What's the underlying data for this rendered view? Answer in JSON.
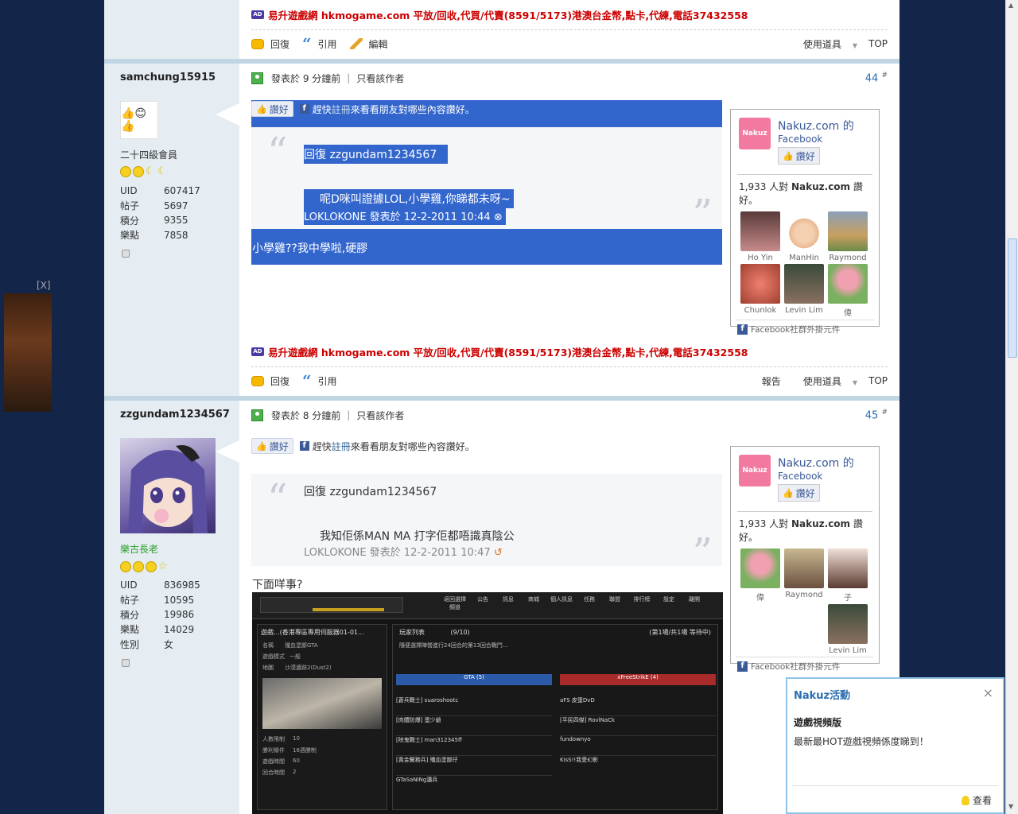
{
  "ad_text": "易升遊戲網 hkmogame.com 平放/回收,代買/代賣(8591/5173)港澳台金幣,點卡,代練,電話37432558",
  "ad_icon": "AD",
  "actions": {
    "reply": "回復",
    "quote": "引用",
    "edit": "編輯",
    "report": "報告",
    "tools": "使用道具",
    "top": "TOP"
  },
  "posts": [
    {
      "username": "samchung15915",
      "rank": "二十四級會員",
      "stats": [
        {
          "k": "UID",
          "v": "607417"
        },
        {
          "k": "帖子",
          "v": "5697"
        },
        {
          "k": "積分",
          "v": "9355"
        },
        {
          "k": "樂點",
          "v": "7858"
        }
      ],
      "posted": "發表於 9 分鐘前",
      "only_author": "只看該作者",
      "floor": "44",
      "floor_sup": "#",
      "like_btn": "讚好",
      "like_prefix": "趕快",
      "like_link": "註冊",
      "like_suffix": "來看看朋友對哪些內容讚好。",
      "quote_title": "回復  zzgundam1234567",
      "quote_text": "呢D咪叫證據LOL,小學雞,你睇都未呀~",
      "quote_meta": "LOKLOKONE 發表於 12-2-2011 10:44",
      "body": "小學雞??我中學啦,硬膠"
    },
    {
      "username": "zzgundam1234567",
      "rank": "樂古長老",
      "stats": [
        {
          "k": "UID",
          "v": "836985"
        },
        {
          "k": "帖子",
          "v": "10595"
        },
        {
          "k": "積分",
          "v": "19986"
        },
        {
          "k": "樂點",
          "v": "14029"
        },
        {
          "k": "性別",
          "v": "女"
        }
      ],
      "posted": "發表於 8 分鐘前",
      "only_author": "只看該作者",
      "floor": "45",
      "floor_sup": "#",
      "like_btn": "讚好",
      "like_prefix": "趕快",
      "like_link": "註冊",
      "like_suffix": "來看看朋友對哪些內容讚好。",
      "quote_title": "回復  zzgundam1234567",
      "quote_text": "我知佢係MAN MA 打字佢都唔識真陰公",
      "quote_meta": "LOKLOKONE 發表於 12-2-2011 10:47",
      "body": "下面咩事?"
    }
  ],
  "fb": {
    "logo": "Nakuz",
    "name": "Nakuz.com",
    "de": " 的",
    "facebook": "Facebook",
    "like": "讚好",
    "count_pre": "1,933 人對 ",
    "count_name": "Nakuz.com",
    "count_post": " 讚好。",
    "footer_fb": "Facebook",
    "footer_plugin": " 社群外掛元件",
    "faces1": [
      "Ho Yin",
      "ManHin",
      "Raymond",
      "Chunlok",
      "Levin Lim",
      "偉"
    ],
    "faces2": [
      "偉",
      "Raymond",
      "子",
      "Levin Lim"
    ]
  },
  "popup": {
    "title": "Nakuz活動",
    "close": "×",
    "subtitle": "遊戲視頻版",
    "text": "最新最HOT遊戲視頻係度睇到！",
    "view": "查看"
  },
  "side_close": "[X]",
  "game": {
    "room_label": "遊戲...(香港專區專用伺服器01-01...",
    "list_title": "玩家列表",
    "list_count": "(9/10)",
    "list_page": "(第1場/共1場 等待中)",
    "team_a": "GTA (5)",
    "team_b": "xFreeStrikE (4)",
    "fields": [
      {
        "k": "名稱",
        "v": "殲血塗鄙GTA"
      },
      {
        "k": "遊戲模式",
        "v": "一般"
      },
      {
        "k": "地圖",
        "v": "沙漠遺跡2(Dust2)"
      }
    ],
    "settings": [
      {
        "k": "人數限制",
        "v": "10"
      },
      {
        "k": "勝利條件",
        "v": "16週勝制"
      },
      {
        "k": "遊戲時間",
        "v": "60"
      },
      {
        "k": "回合時間",
        "v": "2"
      }
    ],
    "toolbar": [
      "返回選擇頻道",
      "公告",
      "訊息",
      "商城",
      "個人訊息",
      "任務",
      "聯盟",
      "排行榜",
      "設定",
      "離開"
    ],
    "players_a": [
      "[蒼兵戰士] suaroshootc",
      "[肉體防爆] 蛋少爺",
      "[除鬼戰士] man312345ff",
      "[黃金醫務兵] 殲血塗鄙仔",
      "GTaSaNINg瀟兵"
    ],
    "players_b": [
      "aFS 皮蛋DvD",
      "[平民四傑] RovlNaCk",
      "fundownyo",
      "KisS!!我愛幻影"
    ],
    "notice": "隨便選擇陣營進行24回合的第13回合戰鬥..."
  }
}
